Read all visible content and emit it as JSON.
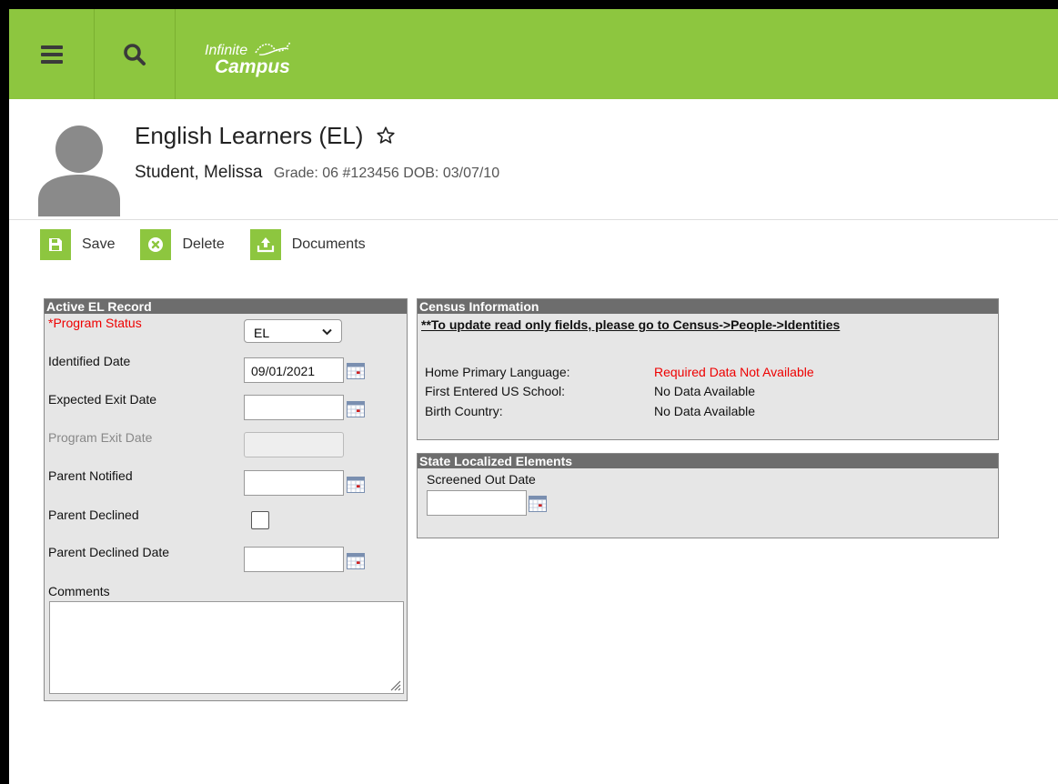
{
  "app": {
    "logo_line1": "Infinite",
    "logo_line2": "Campus",
    "brand_color": "#8dc63f"
  },
  "icons": {
    "menu": "hamburger-menu-icon",
    "search": "search-icon",
    "favorite": "star-outline-icon",
    "save": "floppy-disk-icon",
    "delete": "x-circle-icon",
    "documents": "upload-icon",
    "calendar": "calendar-icon"
  },
  "header": {
    "title": "English Learners (EL)",
    "student_name": "Student, Melissa",
    "student_meta": "Grade: 06 #123456 DOB: 03/07/10"
  },
  "toolbar": {
    "save_label": "Save",
    "delete_label": "Delete",
    "documents_label": "Documents"
  },
  "active_record": {
    "heading": "Active EL Record",
    "program_status_label": "*Program Status",
    "program_status_value": "EL",
    "identified_date_label": "Identified Date",
    "identified_date_value": "09/01/2021",
    "expected_exit_label": "Expected Exit Date",
    "expected_exit_value": "",
    "program_exit_label": "Program Exit Date",
    "program_exit_value": "",
    "parent_notified_label": "Parent Notified",
    "parent_notified_value": "",
    "parent_declined_label": "Parent Declined",
    "parent_declined_checked": false,
    "parent_declined_date_label": "Parent Declined Date",
    "parent_declined_date_value": "",
    "comments_label": "Comments",
    "comments_value": ""
  },
  "census": {
    "heading": "Census Information",
    "note": "**To update read only fields, please go to Census->People->Identities",
    "rows": [
      {
        "label": "Home Primary Language:",
        "value": "Required Data Not Available",
        "warning": true
      },
      {
        "label": "First Entered US School:",
        "value": "No Data Available",
        "warning": false
      },
      {
        "label": "Birth Country:",
        "value": "No Data Available",
        "warning": false
      }
    ],
    "warning_color": "#e00000"
  },
  "state_elements": {
    "heading": "State Localized Elements",
    "screened_out_label": "Screened Out Date",
    "screened_out_value": ""
  }
}
